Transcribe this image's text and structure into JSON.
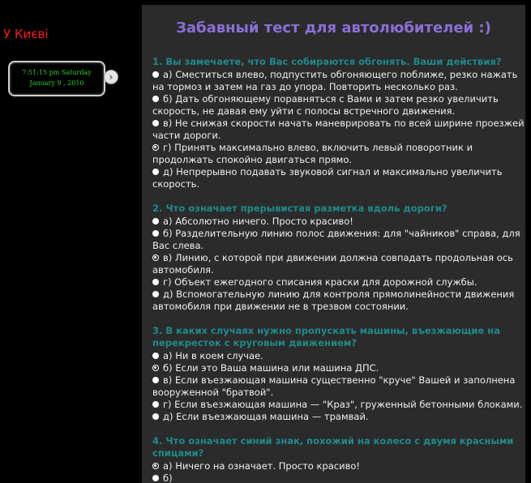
{
  "sidebar": {
    "city_title": "У Києві",
    "clock": {
      "time_line": "7:51:15 pm Saturday",
      "date_line": "January 9 , 2010",
      "nav_icon": "chevron-right-icon"
    }
  },
  "colors": {
    "background": "#000000",
    "panel": "#2b2b2b",
    "title": "#8a6fd6",
    "question": "#1f8a8a",
    "answer_text": "#f0f0f0",
    "city": "#ff1a1a",
    "clock_text": "#33cc33"
  },
  "page": {
    "title": "Забавный тест для автолюбителей :)"
  },
  "questions": [
    {
      "text": "1. Вы замечаете, что Вас собираются обгонять. Ваши действия?",
      "answers": [
        {
          "text": "а) Сместиться влево, подпустить обгоняющего поближе, резко нажать на тормоз и затем на газ до упора. Повторить несколько раз.",
          "checked": false
        },
        {
          "text": "б) Дать обгоняющему поравняться с Вами и затем резко увеличить скорость, не давая ему уйти с полосы встречного движения.",
          "checked": false
        },
        {
          "text": "в) Не снижая скорости начать маневрировать по всей ширине проезжей части дороги.",
          "checked": false
        },
        {
          "text": "г) Принять максимально влево, включить левый поворотник и продолжать спокойно двигаться прямо.",
          "checked": true
        },
        {
          "text": "д) Непрерывно подавать звуковой сигнал и максимально увеличить скорость.",
          "checked": false
        }
      ]
    },
    {
      "text": "2. Что означает прерывистая разметка вдоль дороги?",
      "answers": [
        {
          "text": "а) Абсолютно ничего. Просто красиво!",
          "checked": false
        },
        {
          "text": "б) Разделительную линию полос движения: для \"чайников\" справа, для Вас слева.",
          "checked": false
        },
        {
          "text": "в) Линию, с которой при движении должна совпадать продольная ось автомобиля.",
          "checked": true
        },
        {
          "text": "г) Объект ежегодного списания краски для дорожной службы.",
          "checked": false
        },
        {
          "text": "д) Вспомогательную линию для контроля прямолинейности движения автомобиля при движении не в трезвом состоянии.",
          "checked": false
        }
      ]
    },
    {
      "text": "3. В каких случаях нужно пропускать машины, въезжающие на перекресток с круговым движением?",
      "answers": [
        {
          "text": "а) Ни в коем случае.",
          "checked": false
        },
        {
          "text": "б) Если это Ваша машина или машина ДПС.",
          "checked": true
        },
        {
          "text": "в) Если въезжающая машина существенно \"круче\" Вашей и заполнена вооруженной \"братвой\".",
          "checked": false
        },
        {
          "text": "г) Если въезжающая машина — \"Краз\", груженный бетонными блоками.",
          "checked": false
        },
        {
          "text": "д) Если въезжающая машина — трамвай.",
          "checked": false
        }
      ]
    },
    {
      "text": "4. Что означает синий знак, похожий на колесо с двумя красными спицами?",
      "answers": [
        {
          "text": "а) Ничего на означает. Просто красиво!",
          "checked": true
        },
        {
          "text": "б)",
          "checked": false
        }
      ]
    }
  ]
}
